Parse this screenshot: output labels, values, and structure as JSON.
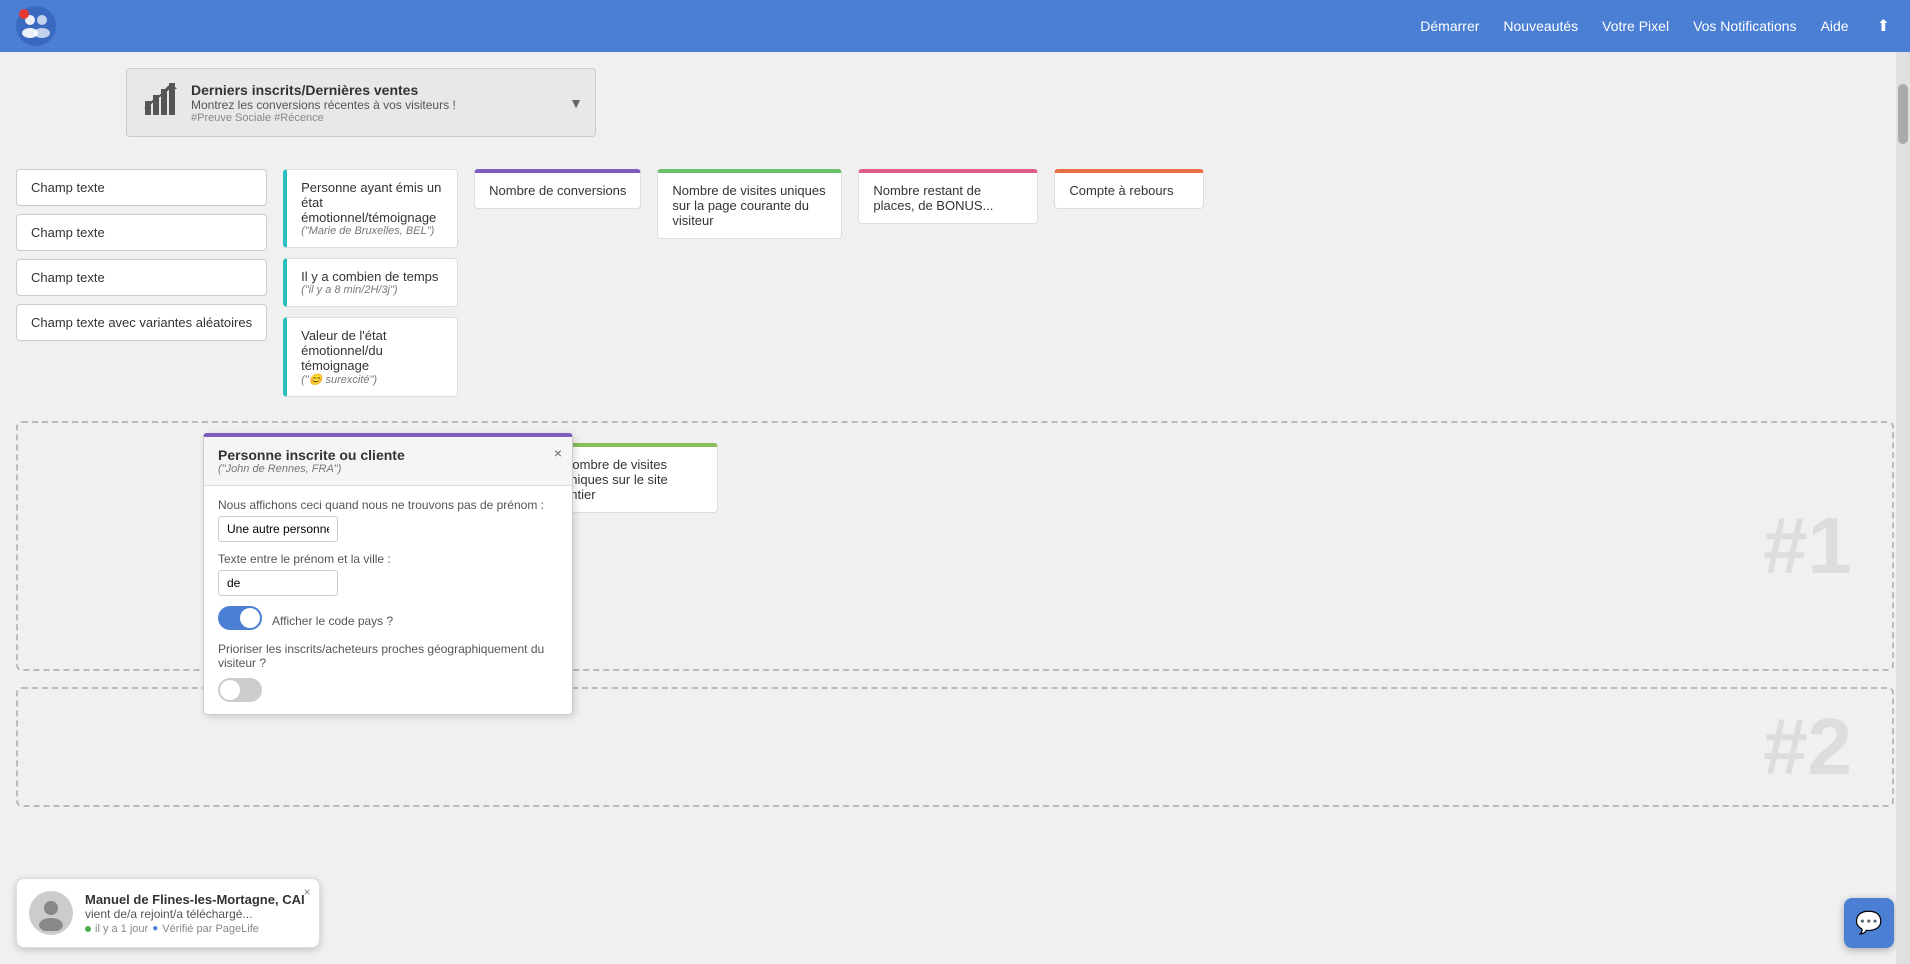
{
  "header": {
    "nav": [
      {
        "label": "Démarrer",
        "key": "demarrer"
      },
      {
        "label": "Nouveautés",
        "key": "nouveautes"
      },
      {
        "label": "Votre Pixel",
        "key": "votre-pixel"
      },
      {
        "label": "Vos Notifications",
        "key": "vos-notifications"
      },
      {
        "label": "Aide",
        "key": "aide"
      }
    ],
    "export_icon": "⬆"
  },
  "derniers_bar": {
    "title": "Derniers inscrits/Dernières ventes",
    "subtitle": "Montrez les conversions récentes à vos visiteurs !",
    "tags": "#Preuve Sociale #Récence",
    "arrow": "▼"
  },
  "champ_cards": [
    {
      "label": "Champ texte"
    },
    {
      "label": "Champ texte"
    },
    {
      "label": "Champ texte"
    },
    {
      "label": "Champ texte avec variantes aléatoires"
    }
  ],
  "person_cards": [
    {
      "label": "Personne ayant émis un état émotionnel/témoignage",
      "sub": "(\"Marie de Bruxelles, BEL\")"
    },
    {
      "label": "Il y a combien de temps",
      "sub": "(\"il y a 8 min/2H/3j\")"
    },
    {
      "label": "Valeur de l'état émotionnel/du témoignage",
      "sub": "(\"😊 surexcité\")"
    }
  ],
  "colored_cards": [
    {
      "label": "Nombre de conversions",
      "color": "purple"
    },
    {
      "label": "Nombre de visites uniques sur la page courante du visiteur",
      "color": "green-dark"
    },
    {
      "label": "Nombre restant de places, de BONUS...",
      "color": "pink"
    },
    {
      "label": "Compte à rebours",
      "color": "orange"
    }
  ],
  "visit_card_global": {
    "label": "Nombre de visites uniques sur le site entier"
  },
  "modal_personne": {
    "title": "Personne inscrite ou cliente",
    "sub": "(\"John de Rennes, FRA\")",
    "label_fallback": "Nous affichons ceci quand nous ne trouvons pas de prénom :",
    "fallback_value": "Une autre personne",
    "label_between": "Texte entre le prénom et la ville :",
    "between_value": "de",
    "label_country": "Afficher le code pays ?",
    "country_toggle": true,
    "label_geopriorize": "Prioriser les inscrits/acheteurs proches géographiquement du visiteur ?",
    "geo_toggle": false,
    "close": "×"
  },
  "dashed_labels": {
    "section1": "#1",
    "section2": "#2"
  },
  "notif_popup": {
    "name": "Manuel de Flines-les-Mortagne, CAI",
    "action": "vient de/a rejoint/a téléchargé...",
    "truncated": "/a télécha",
    "time": "il y a 1 jour",
    "verified": "Vérifié par PageLife",
    "close": "×"
  },
  "chat_button": {
    "icon": "💬"
  }
}
